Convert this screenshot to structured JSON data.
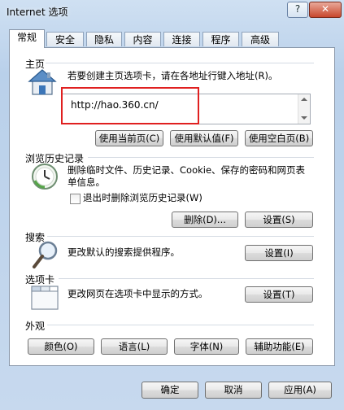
{
  "window": {
    "title": "Internet 选项",
    "help_label": "?",
    "close_label": "✕"
  },
  "tabs": [
    {
      "label": "常规",
      "active": true
    },
    {
      "label": "安全"
    },
    {
      "label": "隐私"
    },
    {
      "label": "内容"
    },
    {
      "label": "连接"
    },
    {
      "label": "程序"
    },
    {
      "label": "高级"
    }
  ],
  "home": {
    "title": "主页",
    "description": "若要创建主页选项卡，请在各地址行键入地址(R)。",
    "url": "http://hao.360.cn/",
    "buttons": {
      "current": "使用当前页(C)",
      "default": "使用默认值(F)",
      "blank": "使用空白页(B)"
    }
  },
  "history": {
    "title": "浏览历史记录",
    "description": "删除临时文件、历史记录、Cookie、保存的密码和网页表单信息。",
    "checkbox_label": "退出时删除浏览历史记录(W)",
    "checkbox_checked": false,
    "delete_label": "删除(D)...",
    "settings_label": "设置(S)"
  },
  "search": {
    "title": "搜索",
    "description": "更改默认的搜索提供程序。",
    "settings_label": "设置(I)"
  },
  "tabs_section": {
    "title": "选项卡",
    "description": "更改网页在选项卡中显示的方式。",
    "settings_label": "设置(T)"
  },
  "appearance": {
    "title": "外观",
    "colors_label": "颜色(O)",
    "languages_label": "语言(L)",
    "fonts_label": "字体(N)",
    "accessibility_label": "辅助功能(E)"
  },
  "footer": {
    "ok_label": "确定",
    "cancel_label": "取消",
    "apply_label": "应用(A)"
  },
  "icons": [
    "house-icon",
    "clock-icon",
    "magnifier-icon",
    "tabs-icon"
  ]
}
